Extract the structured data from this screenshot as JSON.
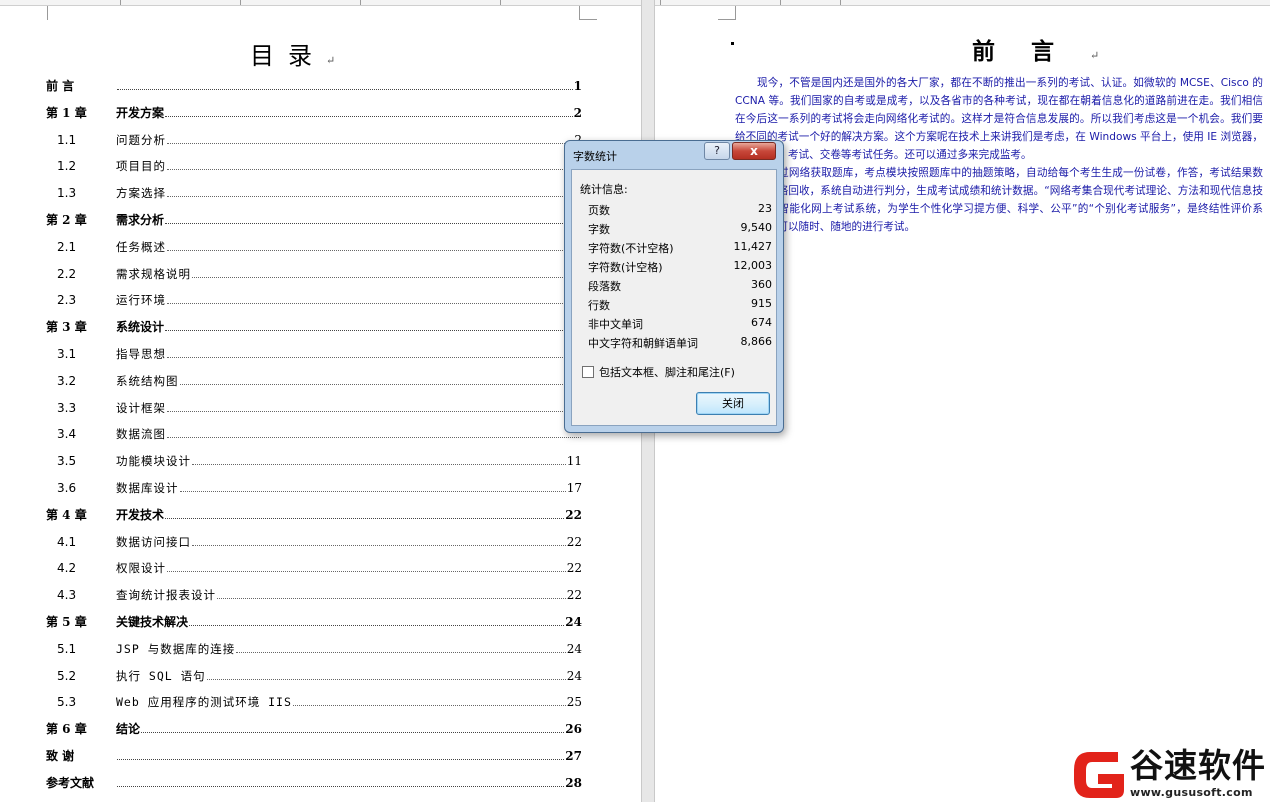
{
  "toc": {
    "title": "目录",
    "para_mark": "↵",
    "entries": [
      {
        "kind": "chap",
        "num": "前  言",
        "label": "",
        "page": "1"
      },
      {
        "kind": "chap",
        "num": "第 1 章",
        "label": "开发方案",
        "page": "2"
      },
      {
        "kind": "sect",
        "num": "1.1",
        "label": "问题分析",
        "page": "2"
      },
      {
        "kind": "sect",
        "num": "1.2",
        "label": "项目目的",
        "page": ""
      },
      {
        "kind": "sect",
        "num": "1.3",
        "label": "方案选择",
        "page": ""
      },
      {
        "kind": "chap",
        "num": "第 2 章",
        "label": "需求分析",
        "page": ""
      },
      {
        "kind": "sect",
        "num": "2.1",
        "label": "任务概述",
        "page": ""
      },
      {
        "kind": "sect",
        "num": "2.2",
        "label": "需求规格说明",
        "page": ""
      },
      {
        "kind": "sect",
        "num": "2.3",
        "label": "运行环境",
        "page": ""
      },
      {
        "kind": "chap",
        "num": "第 3 章",
        "label": "系统设计",
        "page": ""
      },
      {
        "kind": "sect",
        "num": "3.1",
        "label": "指导思想",
        "page": ""
      },
      {
        "kind": "sect",
        "num": "3.2",
        "label": "系统结构图",
        "page": ""
      },
      {
        "kind": "sect",
        "num": "3.3",
        "label": "设计框架",
        "page": ""
      },
      {
        "kind": "sect",
        "num": "3.4",
        "label": "数据流图",
        "page": ""
      },
      {
        "kind": "sect",
        "num": "3.5",
        "label": "功能模块设计",
        "page": "11"
      },
      {
        "kind": "sect",
        "num": "3.6",
        "label": "数据库设计",
        "page": "17"
      },
      {
        "kind": "chap",
        "num": "第 4 章",
        "label": "开发技术",
        "page": "22"
      },
      {
        "kind": "sect",
        "num": "4.1",
        "label": "数据访问接口",
        "page": "22"
      },
      {
        "kind": "sect",
        "num": "4.2",
        "label": "权限设计",
        "page": "22"
      },
      {
        "kind": "sect",
        "num": "4.3",
        "label": "查询统计报表设计",
        "page": "22"
      },
      {
        "kind": "chap",
        "num": "第 5 章",
        "label": "关键技术解决",
        "page": "24"
      },
      {
        "kind": "sect",
        "num": "5.1",
        "label": "JSP 与数据库的连接",
        "page": "24"
      },
      {
        "kind": "sect",
        "num": "5.2",
        "label": "执行 SQL 语句",
        "page": "24"
      },
      {
        "kind": "sect",
        "num": "5.3",
        "label": "Web 应用程序的测试环境 IIS",
        "page": "25"
      },
      {
        "kind": "chap",
        "num": "第 6 章",
        "label": "结论",
        "page": "26"
      },
      {
        "kind": "chap",
        "num": "致  谢",
        "label": "",
        "page": "27"
      },
      {
        "kind": "chap",
        "num": "参考文献",
        "label": "",
        "page": "28"
      }
    ]
  },
  "preface": {
    "title": "前言",
    "para1": "现今，不管是国内还是国外的各大厂家，都在不断的推出一系列的考试、认证。如微软的 MCSE、Cisco 的 CCNA 等。我们国家的自考或是成考，以及各省市的各种考试，现在都在朝着信息化的道路前进在走。我们相信在今后这一系列的考试将会走向网络化考试的。这样才是符合信息发展的。所以我们考虑这是一个机会。我们要给不同的考试一个好的解决方案。这个方案呢在技术上来讲我们是考虑，在 Windows 平台上，使用 IE 浏览器，完成抽题、考试、交卷等考试任务。还可以通过多来完成监考。",
    "para2": "点模块通过网络获取题库，考点模块按照题库中的抽题策略，自动给每个考生生成一份试卷，作答，考试结果数据通过网络回收，系统自动进行判分，生成考试成绩和统计数据。“网络考集合现代考试理论、方法和现代信息技术手段的智能化网上考试系统，为学生个性化学习提方便、科学、公平”的“个别化考试服务”，是终结性评价系统。学生可以随时、随地的进行考试。"
  },
  "dialog": {
    "title": "字数统计",
    "help_label": "?",
    "close_label": "x",
    "group_label": "统计信息:",
    "stats": [
      {
        "label": "页数",
        "value": "23"
      },
      {
        "label": "字数",
        "value": "9,540"
      },
      {
        "label": "字符数(不计空格)",
        "value": "11,427"
      },
      {
        "label": "字符数(计空格)",
        "value": "12,003"
      },
      {
        "label": "段落数",
        "value": "360"
      },
      {
        "label": "行数",
        "value": "915"
      },
      {
        "label": "非中文单词",
        "value": "674"
      },
      {
        "label": "中文字符和朝鲜语单词",
        "value": "8,866"
      }
    ],
    "checkbox_label": "包括文本框、脚注和尾注(F)",
    "checkbox_checked": false,
    "ok_label": "关闭"
  },
  "watermark": {
    "brand": "谷速软件",
    "url": "www.gususoft.com",
    "accent": "#e2231a"
  }
}
